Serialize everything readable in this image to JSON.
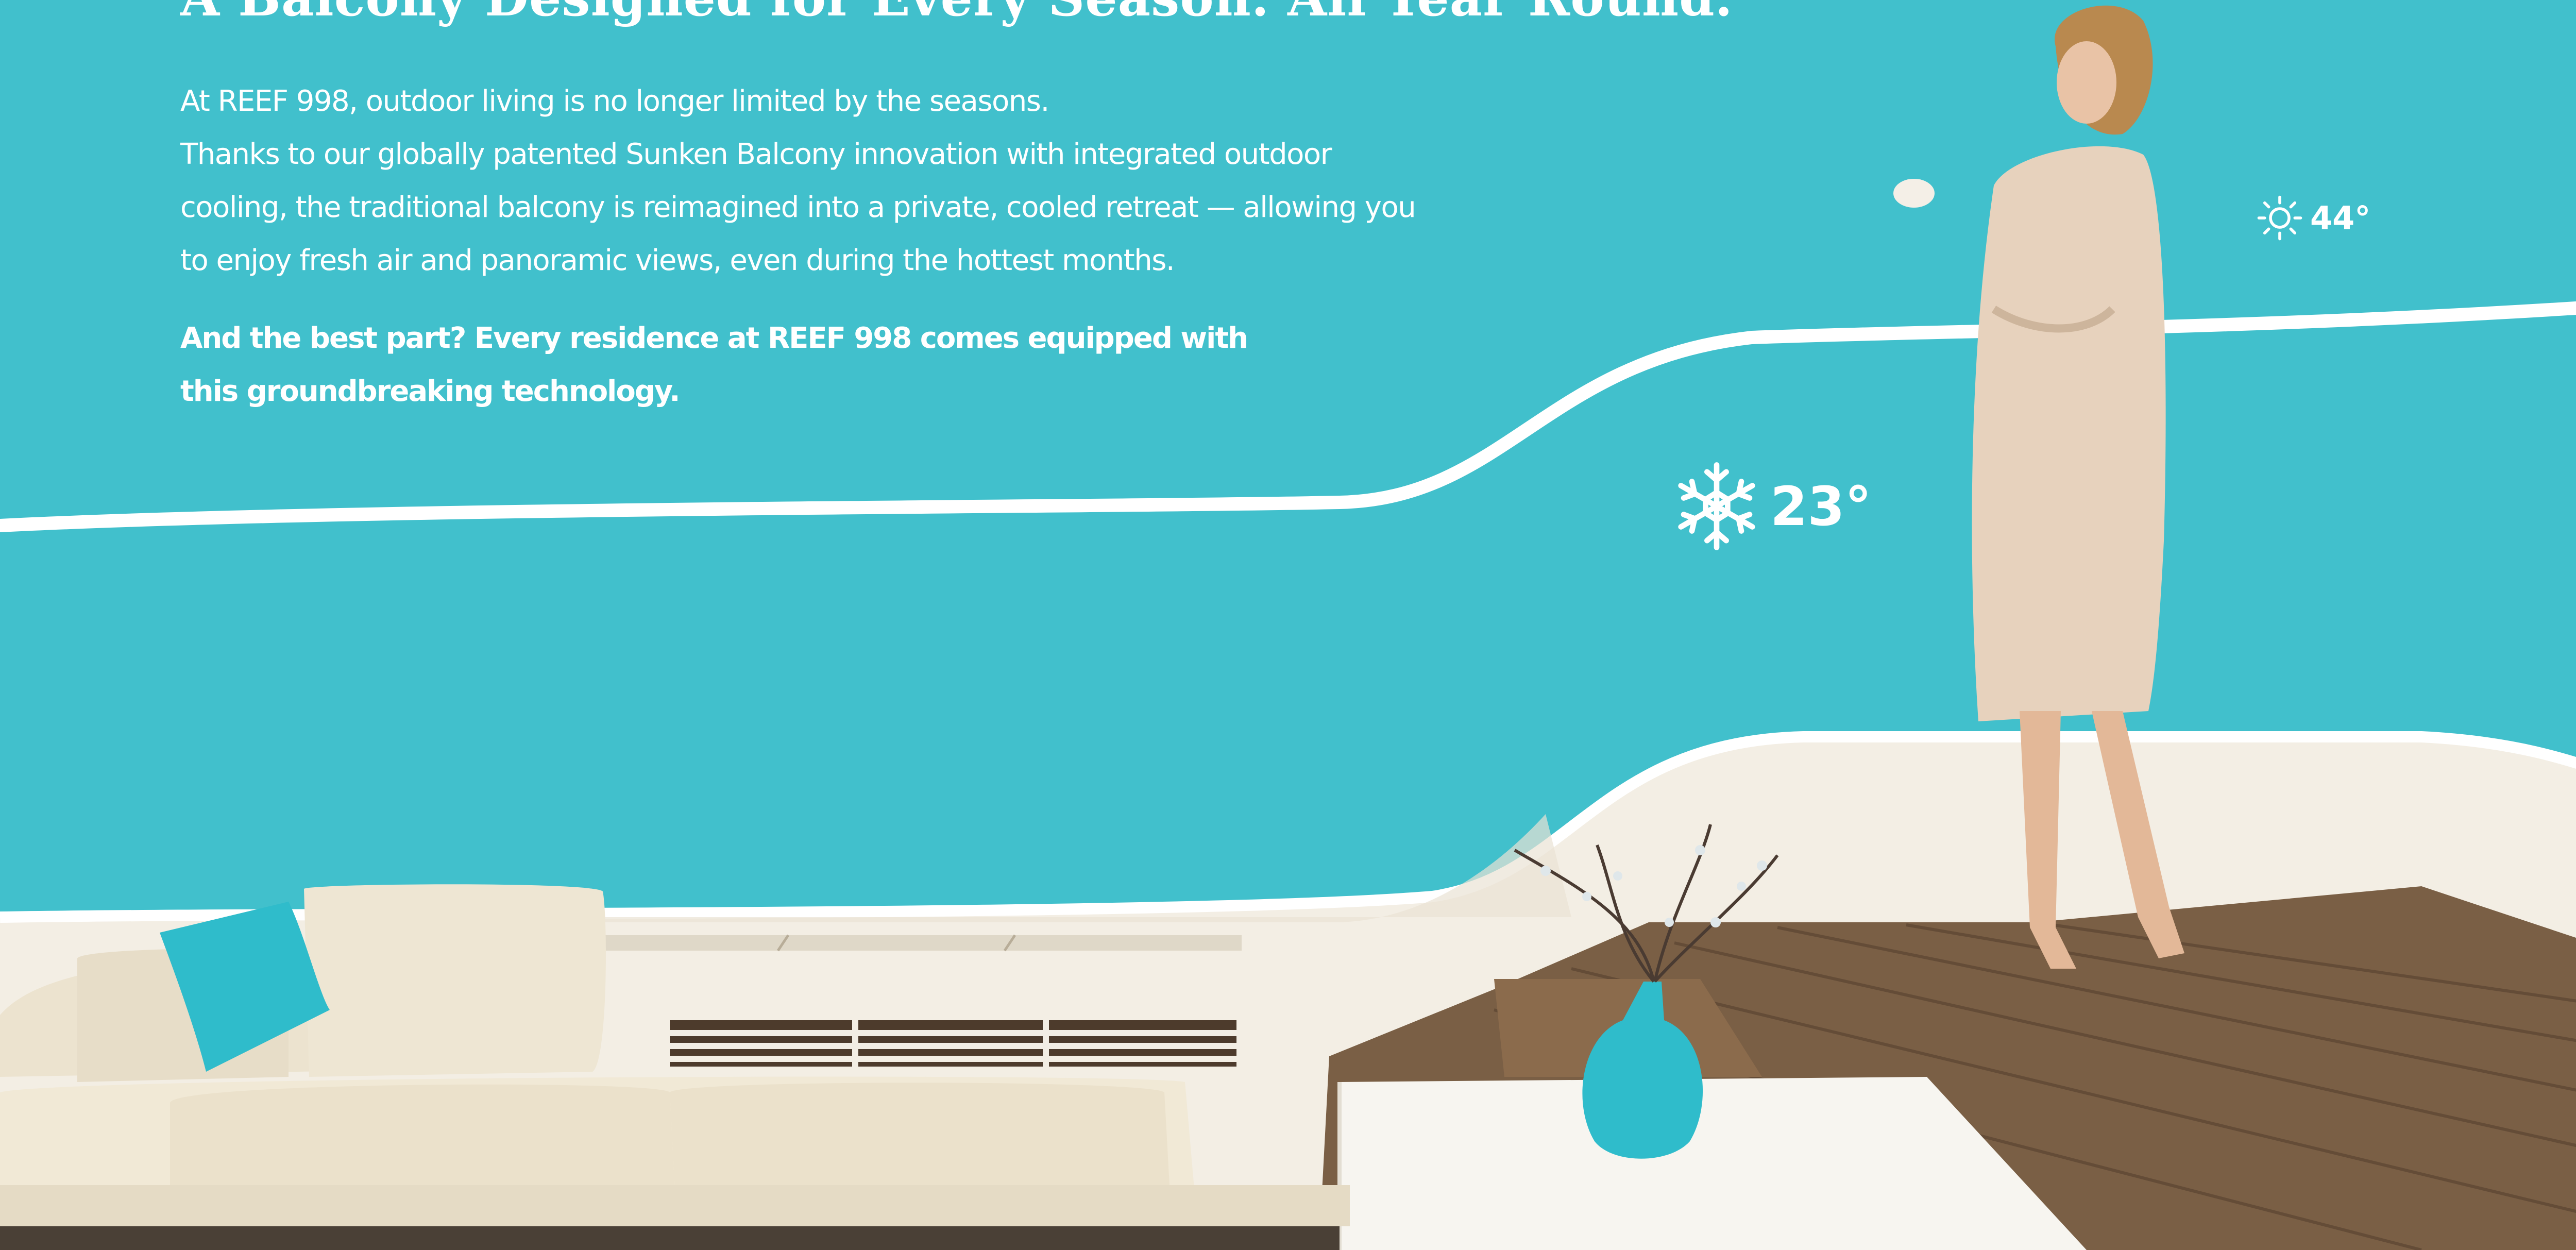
{
  "section": {
    "headline": "A Balcony Designed for Every Season. All Year Round.",
    "intro_lines": [
      "At REEF 998, outdoor living is no longer limited by the seasons.",
      "Thanks to our globally patented Sunken Balcony innovation with integrated outdoor",
      "cooling, the traditional balcony is reimagined into a private, cooled retreat — allowing you",
      "to enjoy fresh air and panoramic views, even during the hottest months."
    ],
    "highlight_lines": [
      "And the best part? Every residence at REEF 998 comes equipped with",
      "this groundbreaking technology."
    ]
  },
  "weather": {
    "outside": {
      "icon": "sun-icon",
      "temperature": "44°"
    },
    "balcony": {
      "icon": "snowflake-icon",
      "temperature": "23°"
    }
  },
  "colors": {
    "background": "#41c0cc",
    "text": "#ffffff",
    "deck_wood": "#7a5f45",
    "wall_cream": "#f3eee4",
    "cushion_accent": "#2fbccb"
  }
}
